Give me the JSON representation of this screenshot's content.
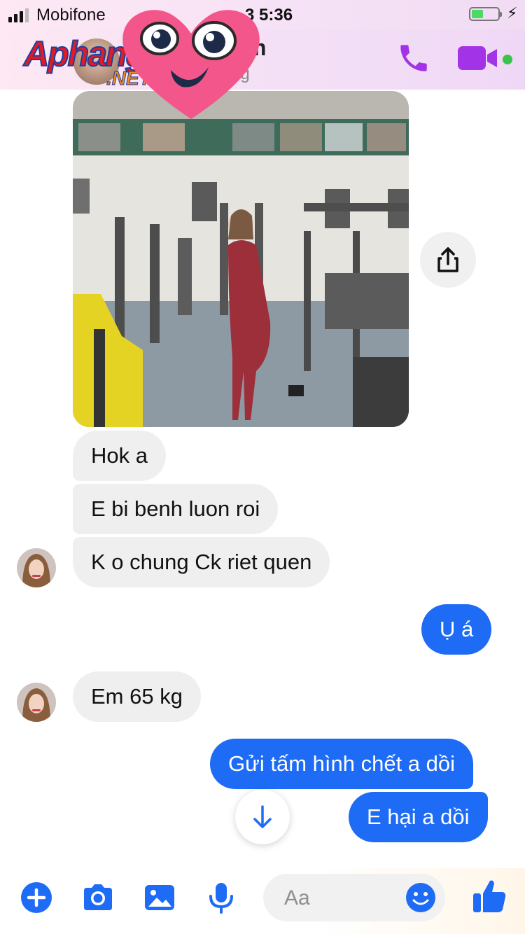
{
  "status_bar": {
    "carrier": "Mobifone",
    "time": "3 5:36"
  },
  "header": {
    "contact_name": "m",
    "contact_status": "ng",
    "online": true
  },
  "watermark": {
    "logo_text": "Aphangs",
    "logo_sub": ".NET"
  },
  "colors": {
    "outgoing_bubble": "#1e6cf5",
    "incoming_bubble": "#efefef",
    "accent_purple": "#a233e6",
    "online_dot": "#3ac24a"
  },
  "messages": [
    {
      "sender": "contact",
      "text": "Hok a"
    },
    {
      "sender": "contact",
      "text": "E bi benh luon roi"
    },
    {
      "sender": "contact",
      "text": "K o chung Ck riet quen"
    },
    {
      "sender": "me",
      "text": "Ụ á"
    },
    {
      "sender": "contact",
      "text": "Em 65 kg"
    },
    {
      "sender": "me",
      "text": "Gửi tấm hình chết a dồi"
    },
    {
      "sender": "me",
      "text": "E hại a dồi"
    }
  ],
  "composer": {
    "placeholder": "Aa",
    "icons": [
      "plus-icon",
      "camera-icon",
      "gallery-icon",
      "microphone-icon",
      "emoji-icon",
      "like-icon"
    ]
  }
}
